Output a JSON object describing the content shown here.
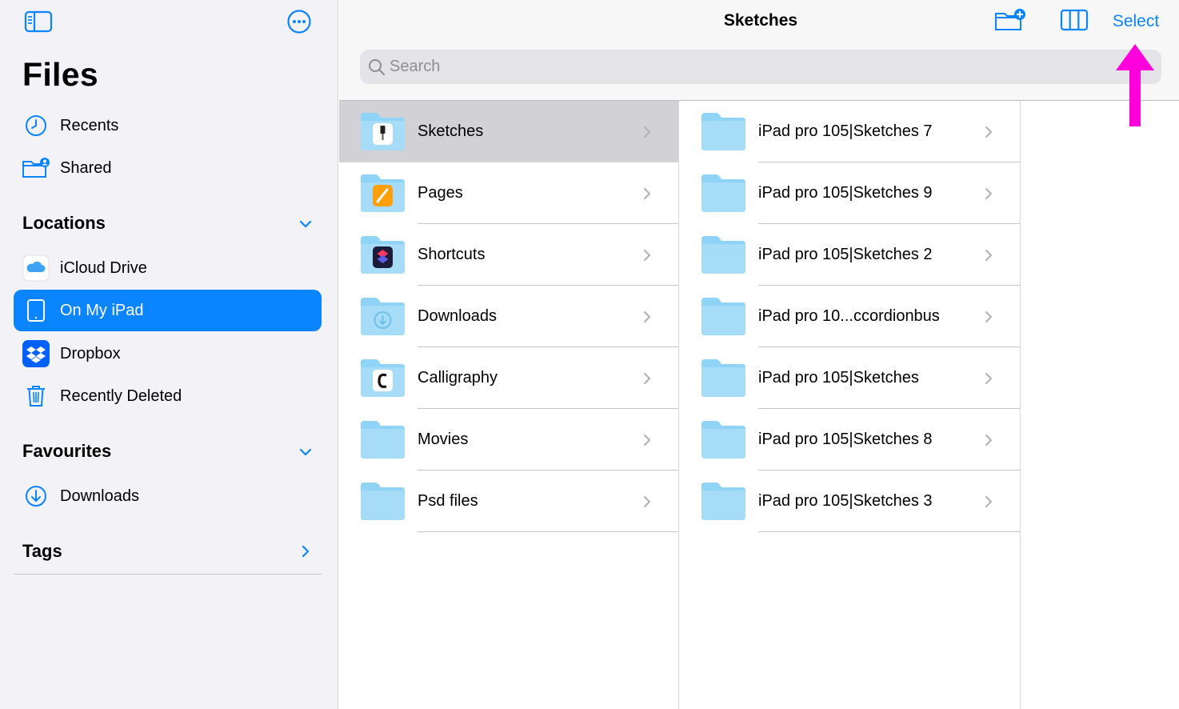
{
  "sidebar": {
    "title": "Files",
    "top_icons": [
      "sidebar-toggle-icon",
      "more-ellipsis-icon"
    ],
    "quick_items": [
      {
        "label": "Recents",
        "icon": "clock-icon"
      },
      {
        "label": "Shared",
        "icon": "shared-folder-icon"
      }
    ],
    "locations_header": "Locations",
    "locations": [
      {
        "label": "iCloud Drive",
        "icon": "icloud-icon"
      },
      {
        "label": "On My iPad",
        "icon": "ipad-icon",
        "selected": true
      },
      {
        "label": "Dropbox",
        "icon": "dropbox-icon"
      },
      {
        "label": "Recently Deleted",
        "icon": "trash-icon"
      }
    ],
    "favourites_header": "Favourites",
    "favourites": [
      {
        "label": "Downloads",
        "icon": "download-circle-icon"
      }
    ],
    "tags_header": "Tags"
  },
  "header": {
    "title": "Sketches",
    "select_label": "Select",
    "search_placeholder": "Search"
  },
  "column1": [
    {
      "name": "Sketches",
      "badge": "sketches-app-icon",
      "selected": true
    },
    {
      "name": "Pages",
      "badge": "pages-app-icon"
    },
    {
      "name": "Shortcuts",
      "badge": "shortcuts-app-icon"
    },
    {
      "name": "Downloads",
      "badge": "download-badge-icon"
    },
    {
      "name": "Calligraphy",
      "badge": "calligraphy-app-icon"
    },
    {
      "name": "Movies",
      "badge": ""
    },
    {
      "name": "Psd files",
      "badge": ""
    }
  ],
  "column2": [
    {
      "name": "iPad pro 105|Sketches 7"
    },
    {
      "name": "iPad pro 105|Sketches 9"
    },
    {
      "name": "iPad pro 105|Sketches 2"
    },
    {
      "name": "iPad pro 10...ccordionbus"
    },
    {
      "name": "iPad pro 105|Sketches"
    },
    {
      "name": "iPad pro 105|Sketches 8"
    },
    {
      "name": "iPad pro 105|Sketches 3"
    }
  ],
  "colors": {
    "accent": "#0a84ff",
    "folder": "#8fd3f7",
    "annotation_arrow": "#ff00dd"
  }
}
